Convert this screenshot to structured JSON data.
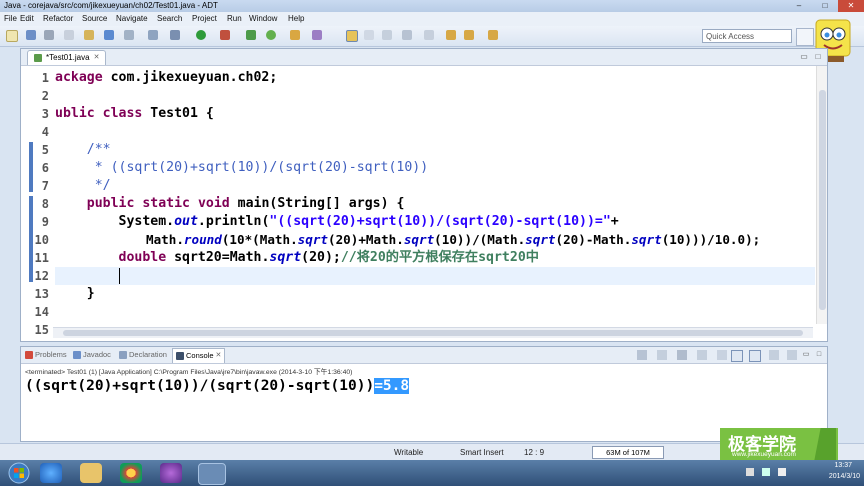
{
  "window": {
    "title": "Java - corejava/src/com/jikexueyuan/ch02/Test01.java - ADT",
    "buttons": [
      "–",
      "□",
      "✕"
    ]
  },
  "menu": [
    "File",
    "Edit",
    "Refactor",
    "Source",
    "Navigate",
    "Search",
    "Project",
    "Run",
    "Window",
    "Help"
  ],
  "toolbar": {
    "quick_access_placeholder": "Quick Access",
    "icons": [
      "new-icon",
      "save-icon",
      "print-icon",
      "debug-icon",
      "run-icon",
      "external-tools-icon",
      "new-java-project-icon",
      "new-package-icon",
      "new-class-icon",
      "open-type-icon",
      "search-icon",
      "toggle-mark-icon",
      "annotation-next-icon",
      "annotation-prev-icon",
      "back-icon",
      "forward-icon"
    ]
  },
  "editor": {
    "tab_label": "*Test01.java",
    "line_numbers": [
      "1",
      "2",
      "3",
      "4",
      "5",
      "6",
      "7",
      "8",
      "9",
      "10",
      "11",
      "12",
      "13",
      "14",
      "15"
    ],
    "lines": [
      "ackage com.jikexueyuan.ch02;",
      "",
      "ublic class Test01 {",
      "",
      "    /**",
      "     * ((sqrt(20)+sqrt(10))/(sqrt(20)-sqrt(10))",
      "     */",
      "    public static void main(String[] args) {",
      "        System.out.println(\"((sqrt(20)+sqrt(10))/(sqrt(20)-sqrt(10))=\"+",
      "            Math.round(10*(Math.sqrt(20)+Math.sqrt(10))/(Math.sqrt(20)-Math.sqrt(10)))/10.0);",
      "        double sqrt20=Math.sqrt(20);//将20的平方根保存在sqrt20中",
      "",
      "    }",
      "",
      ""
    ]
  },
  "console": {
    "tabs": [
      "Problems",
      "Javadoc",
      "Declaration",
      "Console"
    ],
    "active_tab": "Console",
    "status": "<terminated> Test01 (1) [Java Application] C:\\Program Files\\Java\\jre7\\bin\\javaw.exe (2014-3-10 下午1:36:40)",
    "output_expr": "((sqrt(20)+sqrt(10))/(sqrt(20)-sqrt(10))",
    "output_value": "=5.8"
  },
  "statusbar": {
    "writable": "Writable",
    "insert_mode": "Smart Insert",
    "position": "12 : 9",
    "memory": "63M of 107M"
  },
  "watermark": {
    "title": "极客学院",
    "url": "www.jikexueyuan.com"
  },
  "taskbar": {
    "time": "13:37",
    "date": "2014/3/10"
  }
}
